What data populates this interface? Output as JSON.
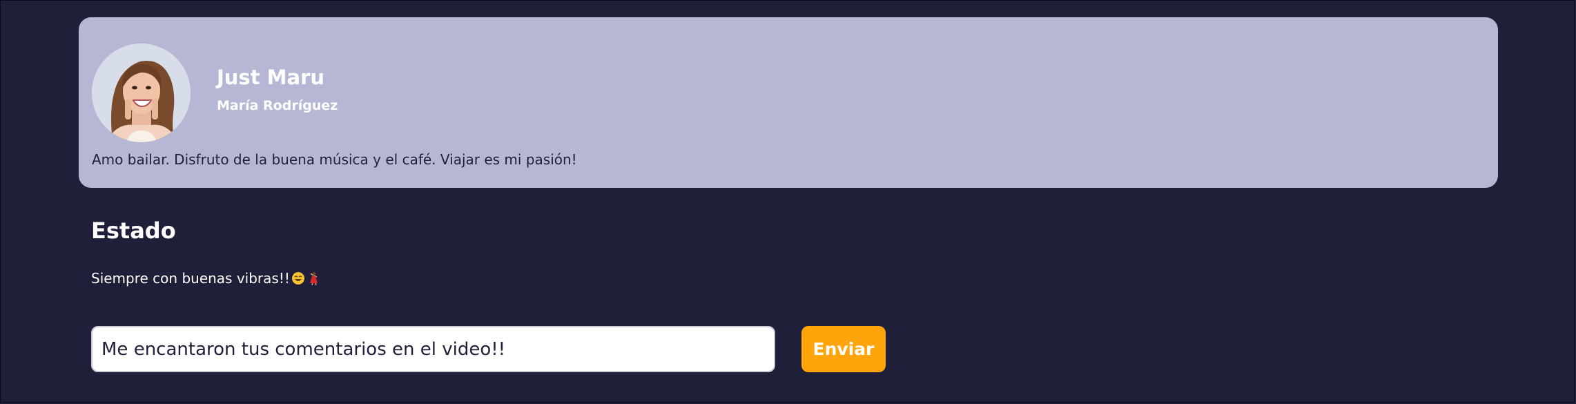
{
  "profile": {
    "display_name": "Just Maru",
    "full_name": "María Rodríguez",
    "bio": "Amo bailar. Disfruto de la buena música y el café. Viajar es mi pasión!",
    "avatar_icon": "profile-photo"
  },
  "status": {
    "heading": "Estado",
    "text": "Siempre con buenas vibras!!",
    "emojis": [
      "grinning-face",
      "woman-dancing"
    ]
  },
  "comment": {
    "value": "Me encantaron tus comentarios en el video!!",
    "send_label": "Enviar"
  },
  "colors": {
    "background": "#1f1f3a",
    "card": "#b6b7d5",
    "accent": "#ffa40a",
    "text_light": "#ffffff",
    "text_dark": "#1f1f3a"
  }
}
